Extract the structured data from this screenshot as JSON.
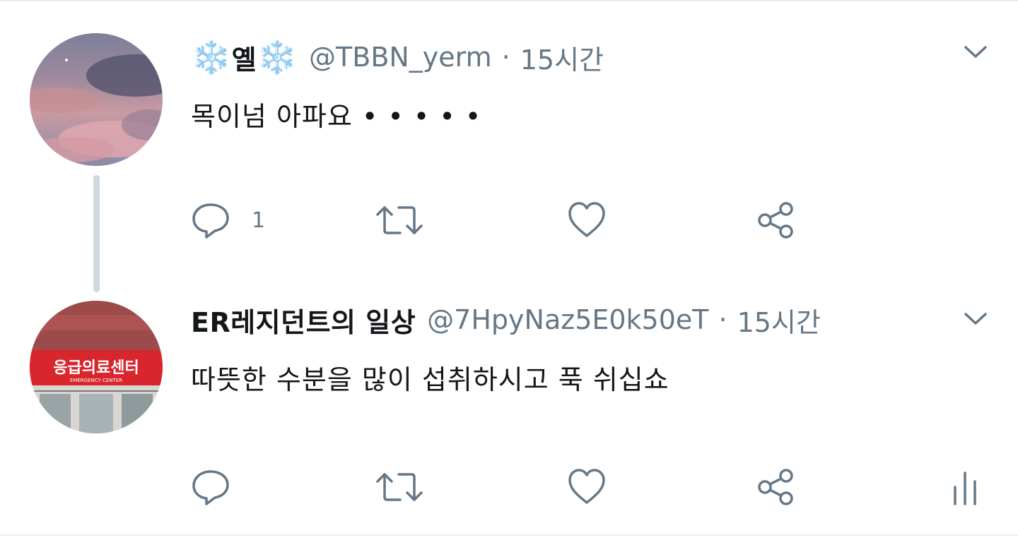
{
  "tweets": [
    {
      "display_name": "옐",
      "name_prefix_emoji": "❄️",
      "name_suffix_emoji": "❄️",
      "handle": "@TBBN_yerm",
      "separator": "·",
      "time": "15시간",
      "text": "목이넘 아파요 • • • • •",
      "reply_count": "1",
      "avatar": "sunset-clouds-sky",
      "icons": [
        "reply-icon",
        "retweet-icon",
        "like-icon",
        "share-icon"
      ]
    },
    {
      "display_name": "ER레지던트의 일상",
      "handle": "@7HpyNaz5E0k50eT",
      "separator": "·",
      "time": "15시간",
      "text": "따뜻한 수분을 많이 섭취하시고 푹 쉬십쇼",
      "reply_count": "",
      "avatar": "emergency-center-sign",
      "avatar_sign_text": "응급의료센터",
      "avatar_sign_subtext": "EMERGENCY CENTER",
      "icons": [
        "reply-icon",
        "retweet-icon",
        "like-icon",
        "share-icon",
        "stats-icon"
      ]
    }
  ],
  "colors": {
    "icon_gray": "#657786",
    "text_dark": "#14171a",
    "thread_line": "#cfd9de",
    "snowflake": "#7cc4ec",
    "sign_red": "#d8262c"
  }
}
